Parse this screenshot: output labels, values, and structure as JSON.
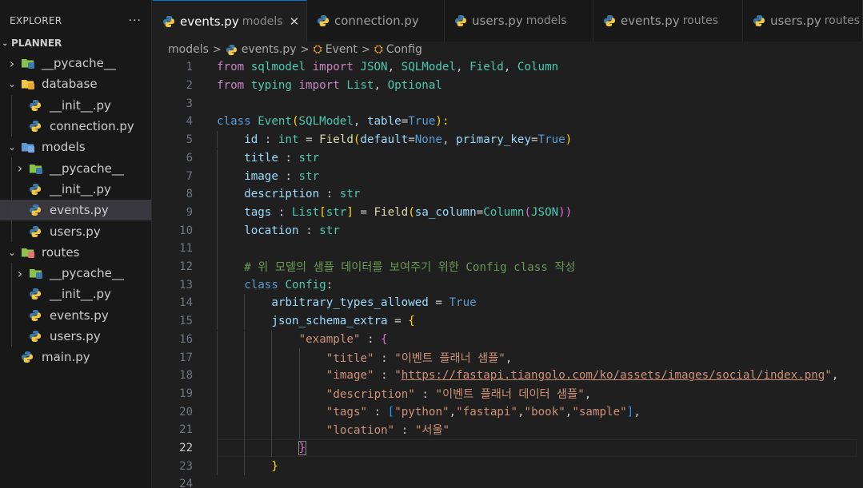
{
  "sidebar": {
    "title": "EXPLORER",
    "more": "···",
    "project": "PLANNER",
    "items": [
      {
        "label": "__pycache__",
        "chevron": "›",
        "icon": "folder-pycache-icon"
      },
      {
        "label": "database",
        "chevron": "⌄",
        "icon": "folder-database-icon"
      },
      {
        "label": "__init__.py",
        "chevron": "",
        "icon": "python-icon"
      },
      {
        "label": "connection.py",
        "chevron": "",
        "icon": "python-icon"
      },
      {
        "label": "models",
        "chevron": "⌄",
        "icon": "folder-models-icon"
      },
      {
        "label": "__pycache__",
        "chevron": "›",
        "icon": "folder-pycache-icon"
      },
      {
        "label": "__init__.py",
        "chevron": "",
        "icon": "python-icon"
      },
      {
        "label": "events.py",
        "chevron": "",
        "icon": "python-icon"
      },
      {
        "label": "users.py",
        "chevron": "",
        "icon": "python-icon"
      },
      {
        "label": "routes",
        "chevron": "⌄",
        "icon": "folder-routes-icon"
      },
      {
        "label": "__pycache__",
        "chevron": "›",
        "icon": "folder-pycache-icon"
      },
      {
        "label": "__init__.py",
        "chevron": "",
        "icon": "python-icon"
      },
      {
        "label": "events.py",
        "chevron": "",
        "icon": "python-icon"
      },
      {
        "label": "users.py",
        "chevron": "",
        "icon": "python-icon"
      },
      {
        "label": "main.py",
        "chevron": "",
        "icon": "python-icon"
      }
    ],
    "selected_index": 7
  },
  "tabs": [
    {
      "label": "events.py",
      "desc": "models",
      "active": true,
      "close": "✕"
    },
    {
      "label": "connection.py",
      "desc": "",
      "active": false
    },
    {
      "label": "users.py",
      "desc": "models",
      "active": false
    },
    {
      "label": "events.py",
      "desc": "routes",
      "active": false
    },
    {
      "label": "users.py",
      "desc": "routes",
      "active": false
    }
  ],
  "breadcrumb": {
    "folder": "models",
    "file": "events.py",
    "class": "Event",
    "member": "Config",
    "separator": ">"
  },
  "editor": {
    "current_line": 22,
    "lines": [
      {
        "n": "1"
      },
      {
        "n": "2"
      },
      {
        "n": "3"
      },
      {
        "n": "4"
      },
      {
        "n": "5"
      },
      {
        "n": "6"
      },
      {
        "n": "7"
      },
      {
        "n": "8"
      },
      {
        "n": "9"
      },
      {
        "n": "10"
      },
      {
        "n": "11"
      },
      {
        "n": "12"
      },
      {
        "n": "13"
      },
      {
        "n": "14"
      },
      {
        "n": "15"
      },
      {
        "n": "16"
      },
      {
        "n": "17"
      },
      {
        "n": "18"
      },
      {
        "n": "19"
      },
      {
        "n": "20"
      },
      {
        "n": "21"
      },
      {
        "n": "22"
      },
      {
        "n": "23"
      },
      {
        "n": "24"
      }
    ],
    "tokens": {
      "l1": [
        "from",
        " ",
        "sqlmodel",
        " ",
        "import",
        " ",
        "JSON",
        ", ",
        "SQLModel",
        ", ",
        "Field",
        ", ",
        "Column"
      ],
      "l2": [
        "from",
        " ",
        "typing",
        " ",
        "import",
        " ",
        "List",
        ", ",
        "Optional"
      ],
      "l4": [
        "class",
        " ",
        "Event",
        "(",
        "SQLModel",
        ", ",
        "table",
        "=",
        "True",
        "):"
      ],
      "l5": [
        "id",
        " : ",
        "int",
        " = ",
        "Field",
        "(",
        "default",
        "=",
        "None",
        ", ",
        "primary_key",
        "=",
        "True",
        ")"
      ],
      "l6": [
        "title",
        " : ",
        "str"
      ],
      "l7": [
        "image",
        " : ",
        "str"
      ],
      "l8": [
        "description",
        " : ",
        "str"
      ],
      "l9": [
        "tags",
        " : ",
        "List",
        "[",
        "str",
        "]",
        " = ",
        "Field",
        "(",
        "sa_column",
        "=",
        "Column",
        "(",
        "JSON",
        "))"
      ],
      "l10": [
        "location",
        " : ",
        "str"
      ],
      "l12": [
        "# 위 모델의 샘플 데이터를 보여주기 위한 Config class 작성"
      ],
      "l13": [
        "class",
        " ",
        "Config",
        ":"
      ],
      "l14": [
        "arbitrary_types_allowed",
        " = ",
        "True"
      ],
      "l15": [
        "json_schema_extra",
        " = ",
        "{"
      ],
      "l16": [
        "\"example\"",
        " : ",
        "{"
      ],
      "l17": [
        "\"title\"",
        " : ",
        "\"이벤트 플래너 샘플\"",
        ","
      ],
      "l18": [
        "\"image\"",
        " : ",
        "\"",
        "https://fastapi.tiangolo.com/ko/assets/images/social/index.png",
        "\"",
        ","
      ],
      "l19": [
        "\"description\"",
        " : ",
        "\"이벤트 플래너 데이터 샘플\"",
        ","
      ],
      "l20": [
        "\"tags\"",
        " : ",
        "[",
        "\"python\"",
        ",",
        "\"fastapi\"",
        ",",
        "\"book\"",
        ",",
        "\"sample\"",
        "]",
        ","
      ],
      "l21": [
        "\"location\"",
        " : ",
        "\"서울\""
      ],
      "l22": [
        "}"
      ],
      "l23": [
        "}"
      ]
    }
  },
  "colors": {
    "accent": "#0078d4",
    "background": "#1f1f1f",
    "sidebar": "#181818"
  }
}
